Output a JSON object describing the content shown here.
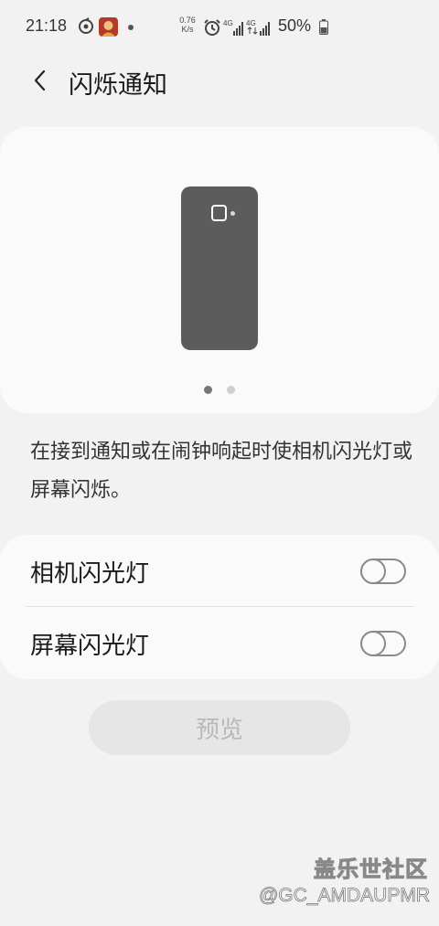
{
  "status_bar": {
    "time": "21:18",
    "network_speed_value": "0.76",
    "network_speed_unit": "K/s",
    "battery": "50%",
    "icons": [
      "sync-icon",
      "app-avatar-icon",
      "notification-dot-icon",
      "alarm-icon",
      "4g-signal-icon",
      "4g-signal-icon",
      "battery-icon"
    ]
  },
  "header": {
    "title": "闪烁通知"
  },
  "preview_card": {
    "pages": 2,
    "active_page": 1
  },
  "description": "在接到通知或在闹钟响起时使相机闪光灯或屏幕闪烁。",
  "settings": [
    {
      "label": "相机闪光灯",
      "enabled": false
    },
    {
      "label": "屏幕闪光灯",
      "enabled": false
    }
  ],
  "preview_button": {
    "label": "预览"
  },
  "watermark": {
    "logo": "盖乐世社区",
    "handle": "@GC_AMDAUPMR"
  }
}
